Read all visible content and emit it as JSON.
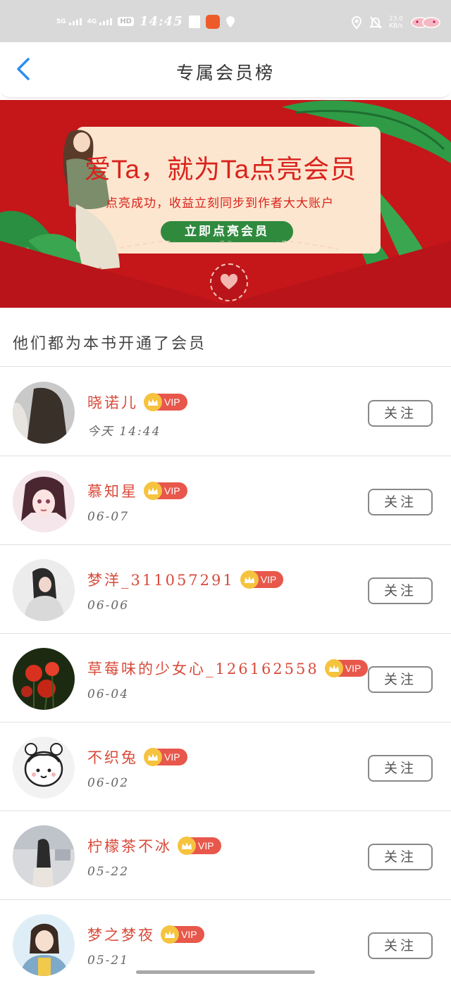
{
  "status_bar": {
    "signal1": "5G",
    "signal2": "4G",
    "hd": "HD",
    "time": "14:45",
    "speed_top": "23.0",
    "speed_bottom": "KB/s"
  },
  "header": {
    "title": "专属会员榜"
  },
  "banner": {
    "headline": "爱Ta，就为Ta点亮会员",
    "subtitle": "点亮成功，收益立刻同步到作者大大账户",
    "cta_label": "立即点亮会员"
  },
  "section_title": "他们都为本书开通了会员",
  "vip_badge_label": "VIP",
  "follow_label": "关注",
  "members": [
    {
      "name": "晓诺儿",
      "date": "今天 14:44"
    },
    {
      "name": "慕知星",
      "date": "06-07"
    },
    {
      "name": "梦洋_311057291",
      "date": "06-06"
    },
    {
      "name": "草莓味的少女心_126162558",
      "date": "06-04"
    },
    {
      "name": "不织兔",
      "date": "06-02"
    },
    {
      "name": "柠檬茶不冰",
      "date": "05-22"
    },
    {
      "name": "梦之梦夜",
      "date": "05-21"
    }
  ],
  "colors": {
    "accent_back": "#2b8ef0",
    "banner_red": "#c5161a",
    "name_red": "#d84a3a",
    "vip_badge": "#e8574b",
    "cta_green": "#2f8a3e"
  }
}
